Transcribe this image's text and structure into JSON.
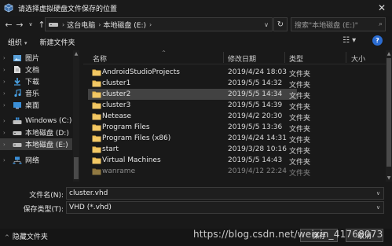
{
  "window": {
    "title": "请选择虚拟硬盘文件保存的位置",
    "close_glyph": "✕"
  },
  "navbar": {
    "back_glyph": "←",
    "forward_glyph": "→",
    "recent_glyph": "∨",
    "up_glyph": "↑",
    "breadcrumbs": [
      "这台电脑",
      "本地磁盘 (E:)"
    ],
    "breadcrumb_sep": "›",
    "dropdown_glyph": "∨",
    "refresh_glyph": "↻",
    "search_placeholder": "搜索\"本地磁盘 (E:)\"",
    "search_glyph": "⌕"
  },
  "toolbar": {
    "organize_label": "组织",
    "organize_caret": "▾",
    "new_folder_label": "新建文件夹",
    "view_glyph": "☷ ▾",
    "help_glyph": "?"
  },
  "sidebar": {
    "items": [
      {
        "label": "图片",
        "icon": "pictures-icon",
        "chevron": "›"
      },
      {
        "label": "文档",
        "icon": "documents-icon",
        "chevron": "›"
      },
      {
        "label": "下载",
        "icon": "downloads-icon",
        "chevron": "›"
      },
      {
        "label": "音乐",
        "icon": "music-icon",
        "chevron": "›"
      },
      {
        "label": "桌面",
        "icon": "desktop-icon",
        "chevron": "›"
      },
      {
        "label": "Windows (C:)",
        "icon": "windows-drive-icon",
        "chevron": "›"
      },
      {
        "label": "本地磁盘 (D:)",
        "icon": "drive-icon",
        "chevron": "›"
      },
      {
        "label": "本地磁盘 (E:)",
        "icon": "drive-icon",
        "chevron": "›",
        "selected": true
      },
      {
        "label": "网络",
        "icon": "network-icon",
        "chevron": "›"
      }
    ],
    "scroll_up_glyph": "▲"
  },
  "filelist": {
    "columns": {
      "name": "名称",
      "date": "修改日期",
      "type": "类型",
      "size": "大小"
    },
    "sort_glyph": "^",
    "rows": [
      {
        "name": "AndroidStudioProjects",
        "date": "2019/4/24 18:03",
        "type": "文件夹"
      },
      {
        "name": "cluster1",
        "date": "2019/5/5 14:32",
        "type": "文件夹"
      },
      {
        "name": "cluster2",
        "date": "2019/5/5 14:34",
        "type": "文件夹",
        "selected": true
      },
      {
        "name": "cluster3",
        "date": "2019/5/5 14:39",
        "type": "文件夹"
      },
      {
        "name": "Netease",
        "date": "2019/4/2 20:30",
        "type": "文件夹"
      },
      {
        "name": "Program Files",
        "date": "2019/5/5 13:36",
        "type": "文件夹"
      },
      {
        "name": "Program Files (x86)",
        "date": "2019/4/24 14:31",
        "type": "文件夹"
      },
      {
        "name": "start",
        "date": "2019/3/28 10:16",
        "type": "文件夹"
      },
      {
        "name": "Virtual Machines",
        "date": "2019/5/5 14:43",
        "type": "文件夹"
      },
      {
        "name": "wanrame",
        "date": "2019/4/12 22:24",
        "type": "文件夹"
      }
    ],
    "scroll_up_glyph": "▲",
    "scroll_down_glyph": "▼"
  },
  "form": {
    "filename_label": "文件名(N):",
    "filename_value": "cluster.vhd",
    "filetype_label": "保存类型(T):",
    "filetype_value": "VHD (*.vhd)",
    "dropdown_glyph": "∨"
  },
  "footer": {
    "hide_folders_caret": "^",
    "hide_folders_label": "隐藏文件夹",
    "save_label": "保存",
    "cancel_label": "取消",
    "watermark": "https://blog.csdn.net/weixin_41768073"
  },
  "colors": {
    "folder": "#e8b850",
    "accent": "#2b6cd1",
    "selection": "#424242",
    "background": "#191919"
  }
}
